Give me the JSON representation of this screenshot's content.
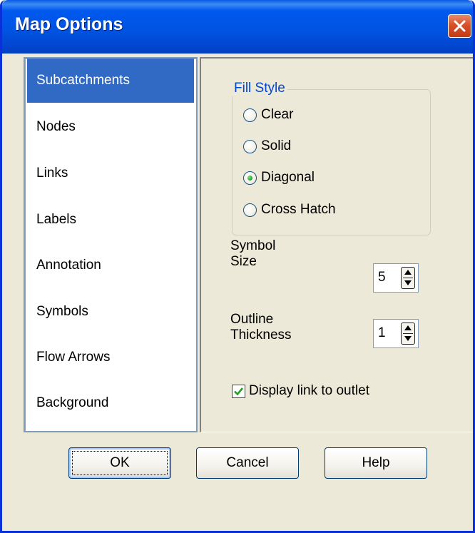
{
  "window": {
    "title": "Map Options"
  },
  "sidebar": {
    "items": [
      {
        "label": "Subcatchments",
        "selected": true
      },
      {
        "label": "Nodes"
      },
      {
        "label": "Links"
      },
      {
        "label": "Labels"
      },
      {
        "label": "Annotation"
      },
      {
        "label": "Symbols"
      },
      {
        "label": "Flow Arrows"
      },
      {
        "label": "Background"
      }
    ]
  },
  "fill_style": {
    "legend": "Fill Style",
    "options": [
      {
        "label": "Clear",
        "checked": false
      },
      {
        "label": "Solid",
        "checked": false
      },
      {
        "label": "Diagonal",
        "checked": true
      },
      {
        "label": "Cross Hatch",
        "checked": false
      }
    ]
  },
  "symbol_size": {
    "label_line1": "Symbol",
    "label_line2": "Size",
    "value": "5"
  },
  "outline_thickness": {
    "label_line1": "Outline",
    "label_line2": "Thickness",
    "value": "1"
  },
  "display_link": {
    "label": "Display link to outlet",
    "checked": true
  },
  "buttons": {
    "ok": "OK",
    "cancel": "Cancel",
    "help": "Help"
  },
  "colors": {
    "titlebar": "#0054e3",
    "selection": "#316ac5",
    "legend_text": "#0046d5",
    "dialog_bg": "#ece9d8"
  }
}
